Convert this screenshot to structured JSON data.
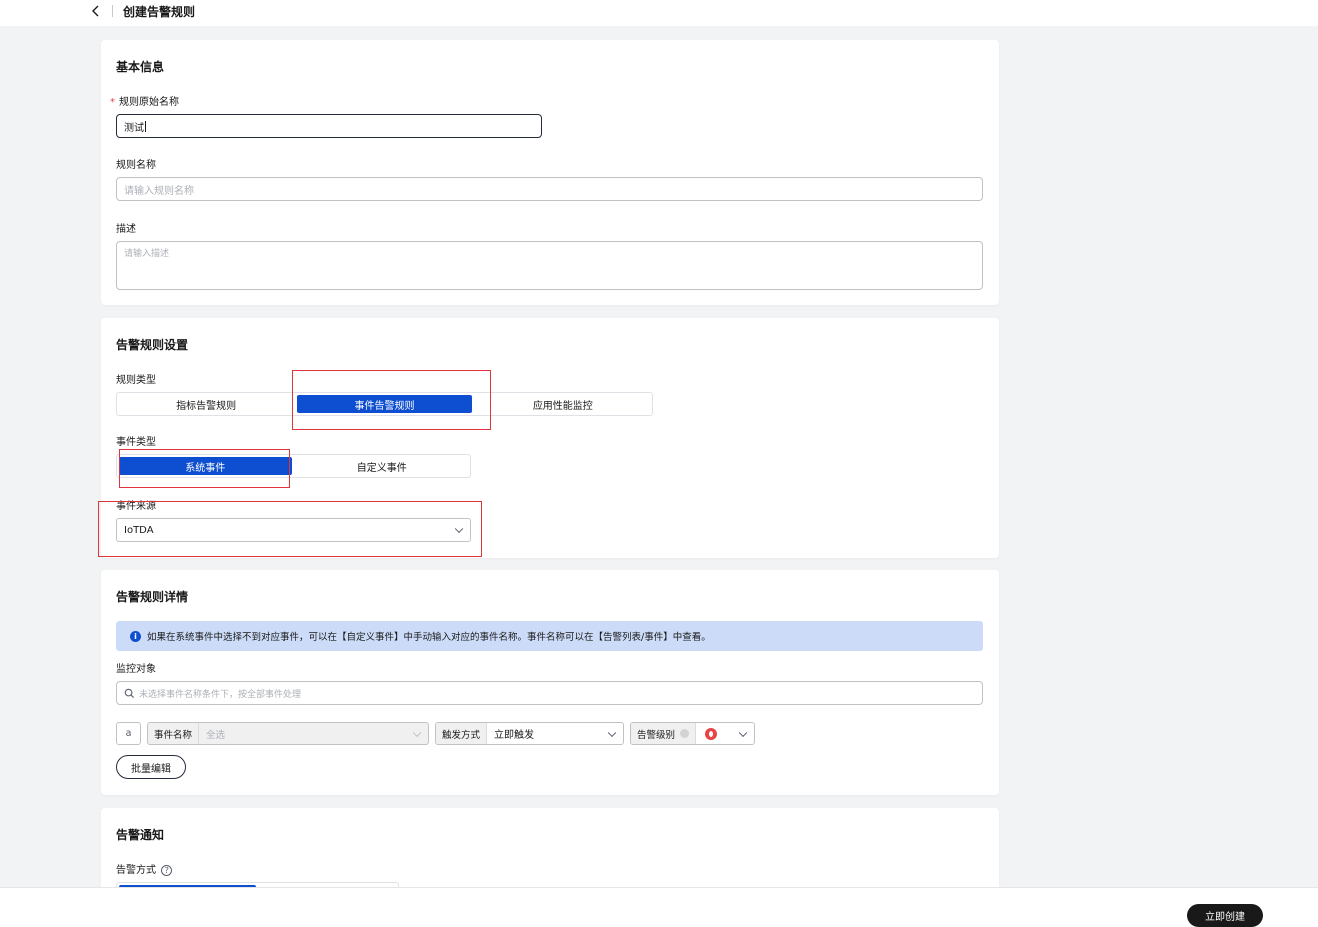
{
  "header": {
    "title": "创建告警规则"
  },
  "basic": {
    "section_title": "基本信息",
    "rule_original_name_label": "规则原始名称",
    "rule_original_name_value": "测试",
    "rule_name_label": "规则名称",
    "rule_name_placeholder": "请输入规则名称",
    "desc_label": "描述",
    "desc_placeholder": "请输入描述"
  },
  "settings": {
    "section_title": "告警规则设置",
    "rule_type_label": "规则类型",
    "rule_types": [
      "指标告警规则",
      "事件告警规则",
      "应用性能监控"
    ],
    "rule_type_selected": "事件告警规则",
    "event_type_label": "事件类型",
    "event_types": [
      "系统事件",
      "自定义事件"
    ],
    "event_type_selected": "系统事件",
    "event_source_label": "事件来源",
    "event_source_value": "IoTDA"
  },
  "details": {
    "section_title": "告警规则详情",
    "info_text": "如果在系统事件中选择不到对应事件，可以在【自定义事件】中手动输入对应的事件名称。事件名称可以在【告警列表/事件】中查看。",
    "monitor_label": "监控对象",
    "monitor_placeholder": "未选择事件名称条件下，按全部事件处理",
    "row_index": "a",
    "event_name_tag": "事件名称",
    "event_name_value": "全选",
    "trigger_tag": "触发方式",
    "trigger_value": "立即触发",
    "level_tag": "告警级别",
    "batch_edit": "批量编辑"
  },
  "notify": {
    "section_title": "告警通知",
    "method_label": "告警方式"
  },
  "footer": {
    "create_button": "立即创建"
  },
  "colors": {
    "primary": "#0e4fd1",
    "highlight_box": "#e0353d",
    "danger": "#e54545"
  }
}
